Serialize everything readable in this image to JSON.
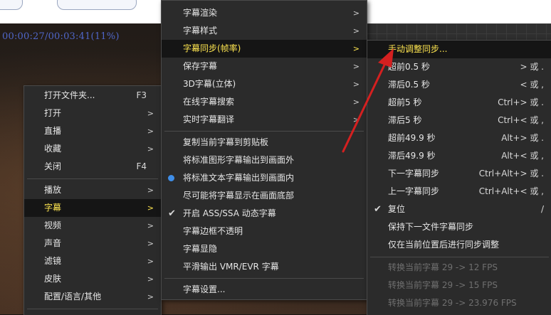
{
  "player": {
    "timecode": "00:00:27/00:03:41(11%)"
  },
  "menu_main": {
    "items": [
      {
        "label": "打开文件夹...",
        "shortcut": "F3"
      },
      {
        "label": "打开",
        "submenu": true
      },
      {
        "label": "直播",
        "submenu": true
      },
      {
        "label": "收藏",
        "submenu": true
      },
      {
        "label": "关闭",
        "shortcut": "F4"
      },
      {
        "label": "播放",
        "submenu": true
      },
      {
        "label": "字幕",
        "submenu": true,
        "highlighted": true
      },
      {
        "label": "视频",
        "submenu": true
      },
      {
        "label": "声音",
        "submenu": true
      },
      {
        "label": "滤镜",
        "submenu": true
      },
      {
        "label": "皮肤",
        "submenu": true
      },
      {
        "label": "配置/语言/其他",
        "submenu": true
      }
    ]
  },
  "menu_subtitle": {
    "items": [
      {
        "label": "字幕渲染",
        "submenu": true
      },
      {
        "label": "字幕样式",
        "submenu": true
      },
      {
        "label": "字幕同步(帧率)",
        "submenu": true,
        "highlighted": true
      },
      {
        "label": "保存字幕",
        "submenu": true
      },
      {
        "label": "3D字幕(立体)",
        "submenu": true
      },
      {
        "label": "在线字幕搜索",
        "submenu": true
      },
      {
        "label": "实时字幕翻译",
        "submenu": true
      },
      {
        "label": "复制当前字幕到剪贴板"
      },
      {
        "label": "将标准图形字幕输出到画面外"
      },
      {
        "label": "将标准文本字幕输出到画面内",
        "radio": true
      },
      {
        "label": "尽可能将字幕显示在画面底部"
      },
      {
        "label": "开启 ASS/SSA 动态字幕",
        "checked": true
      },
      {
        "label": "字幕边框不透明"
      },
      {
        "label": "字幕显隐"
      },
      {
        "label": "平滑输出 VMR/EVR 字幕"
      },
      {
        "label": "字幕设置..."
      }
    ]
  },
  "menu_sync": {
    "items": [
      {
        "label": "手动调整同步...",
        "highlighted": true
      },
      {
        "label": "超前0.5 秒",
        "shortcut": "> 或 ."
      },
      {
        "label": "滞后0.5 秒",
        "shortcut": "< 或 ,"
      },
      {
        "label": "超前5 秒",
        "shortcut": "Ctrl+> 或 ."
      },
      {
        "label": "滞后5 秒",
        "shortcut": "Ctrl+< 或 ,"
      },
      {
        "label": "超前49.9 秒",
        "shortcut": "Alt+> 或 ."
      },
      {
        "label": "滞后49.9 秒",
        "shortcut": "Alt+< 或 ,"
      },
      {
        "label": "下一字幕同步",
        "shortcut": "Ctrl+Alt+> 或 ."
      },
      {
        "label": "上一字幕同步",
        "shortcut": "Ctrl+Alt+< 或 ,"
      },
      {
        "label": "复位",
        "shortcut": "/",
        "checked": true
      },
      {
        "label": "保持下一文件字幕同步"
      },
      {
        "label": "仅在当前位置后进行同步调整"
      },
      {
        "label": "转换当前字幕 29 -> 12 FPS",
        "disabled": true
      },
      {
        "label": "转换当前字幕 29 -> 15 FPS",
        "disabled": true
      },
      {
        "label": "转换当前字幕 29 -> 23.976 FPS",
        "disabled": true
      }
    ]
  },
  "colors": {
    "highlight_text": "#ffe650",
    "annotation_arrow": "#d42020",
    "timecode": "#4f66c8"
  }
}
